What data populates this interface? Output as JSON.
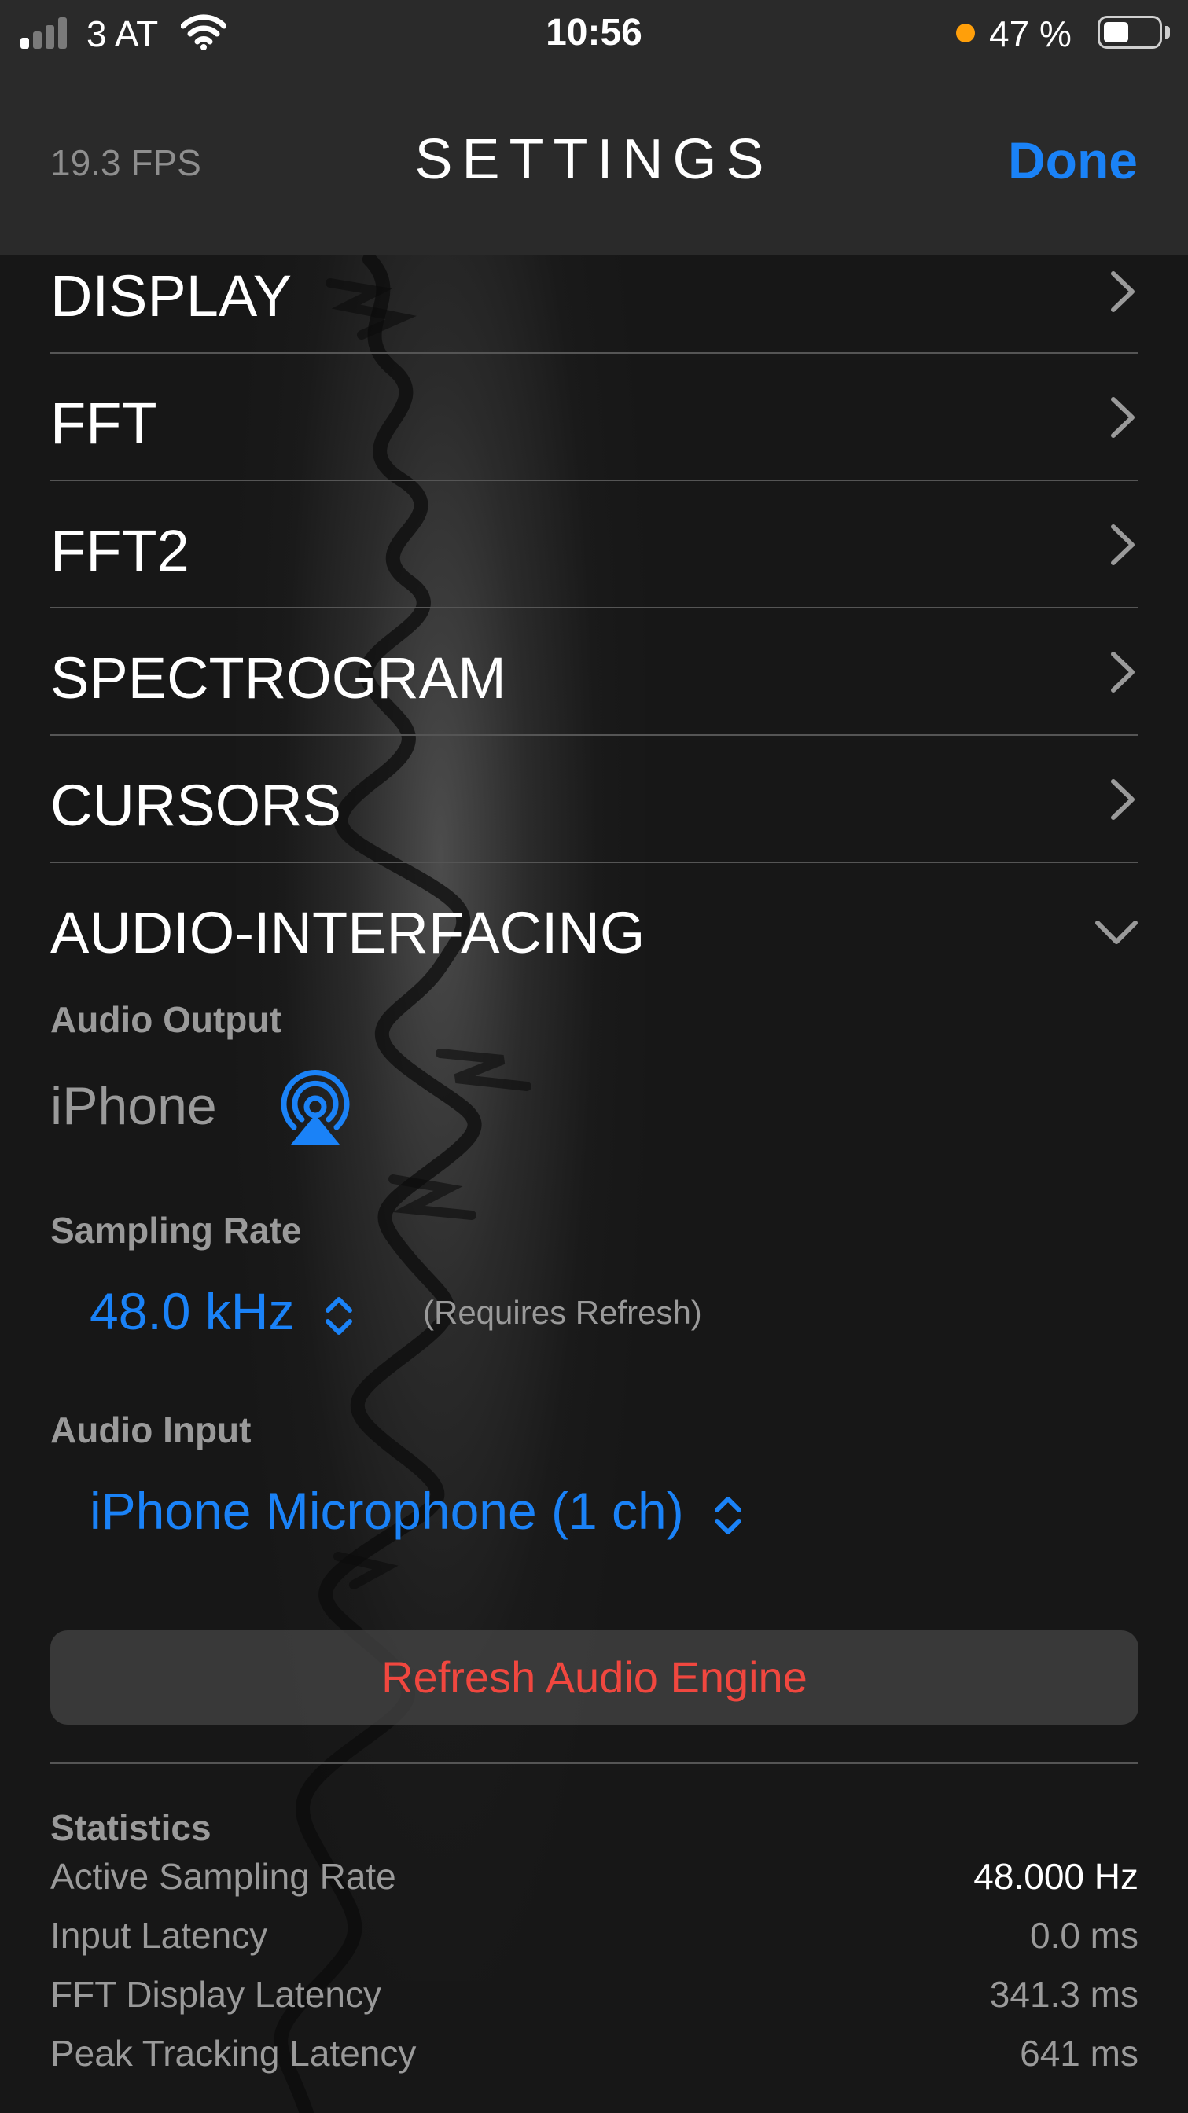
{
  "status_bar": {
    "carrier": "3 AT",
    "time": "10:56",
    "battery_percent": "47 %",
    "battery_level": 0.47,
    "orange_dot_color": "#ff9f0a",
    "icons": [
      "cellular-signal-icon",
      "wifi-icon",
      "battery-icon"
    ]
  },
  "nav": {
    "fps": "19.3 FPS",
    "title": "SETTINGS",
    "done_label": "Done"
  },
  "menu": {
    "items": [
      {
        "label": "DISPLAY"
      },
      {
        "label": "FFT"
      },
      {
        "label": "FFT2"
      },
      {
        "label": "SPECTROGRAM"
      },
      {
        "label": "CURSORS"
      }
    ],
    "expanded": {
      "label": "AUDIO-INTERFACING"
    }
  },
  "audio": {
    "output_label": "Audio Output",
    "output_value": "iPhone",
    "sampling_label": "Sampling Rate",
    "sampling_value": "48.0 kHz",
    "sampling_note": "(Requires Refresh)",
    "input_label": "Audio Input",
    "input_value": "iPhone Microphone (1 ch)",
    "refresh_label": "Refresh Audio Engine"
  },
  "statistics": {
    "title": "Statistics",
    "rows": [
      {
        "name": "Active Sampling Rate",
        "value": "48.000 Hz"
      },
      {
        "name": "Input Latency",
        "value": "0.0 ms"
      },
      {
        "name": "FFT Display Latency",
        "value": "341.3 ms"
      },
      {
        "name": "Peak Tracking Latency",
        "value": "641 ms"
      }
    ]
  },
  "colors": {
    "accent": "#1a82f7",
    "destructive": "#f0473f",
    "background": "#171717",
    "bar": "#2a2a2a"
  }
}
